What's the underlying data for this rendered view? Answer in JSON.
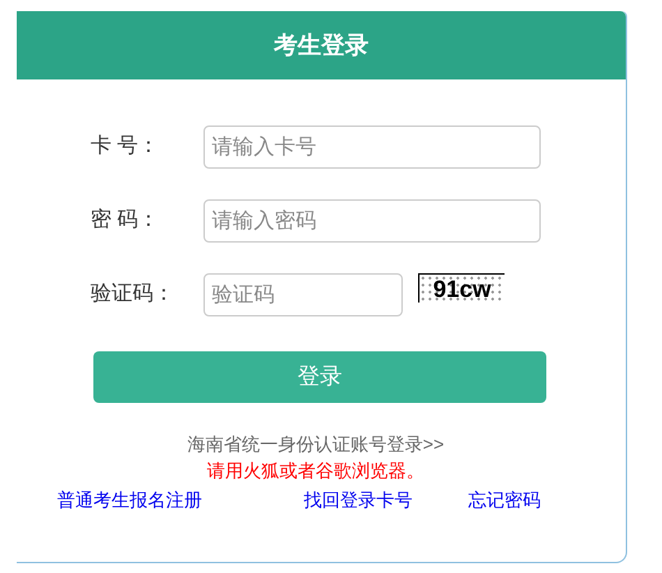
{
  "header": {
    "title": "考生登录"
  },
  "fields": [
    {
      "label": "卡 号：",
      "placeholder": "请输入卡号",
      "kind": "text"
    },
    {
      "label": "密 码：",
      "placeholder": "请输入密码",
      "kind": "password"
    },
    {
      "label": "验证码：",
      "placeholder": "验证码",
      "kind": "captcha",
      "captcha": "91cw"
    }
  ],
  "login_button": "登录",
  "unified_login_link": "海南省统一身份认证账号登录>>",
  "browser_notice": "请用火狐或者谷歌浏览器。",
  "links": [
    "普通考生报名注册",
    "找回登录卡号",
    "忘记密码"
  ]
}
